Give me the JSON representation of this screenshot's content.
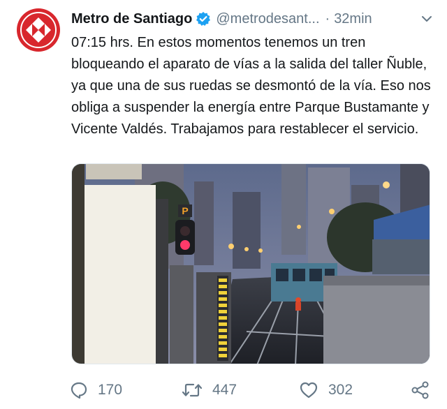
{
  "tweet": {
    "author_name": "Metro de Santiago",
    "handle": "@metrodesant...",
    "separator": "·",
    "time": "32min",
    "text": "07:15 hrs. En estos momentos tenemos un tren bloqueando el aparato de vías a la salida del taller Ñuble, ya que una de sus ruedas se desmontó de la vía. Eso nos obliga a suspender la energía entre Parque Bustamante y Vicente Valdés. Trabajamos para restablecer el servicio."
  },
  "media": {
    "signal_letter": "P"
  },
  "actions": {
    "replies": "170",
    "retweets": "447",
    "likes": "302"
  },
  "colors": {
    "brand_red": "#d8272d",
    "verified_blue": "#1da1f2",
    "muted": "#657786"
  },
  "icons": [
    "metro-logo-icon",
    "verified-icon",
    "chevron-down-icon",
    "reply-icon",
    "retweet-icon",
    "like-icon",
    "share-icon"
  ]
}
